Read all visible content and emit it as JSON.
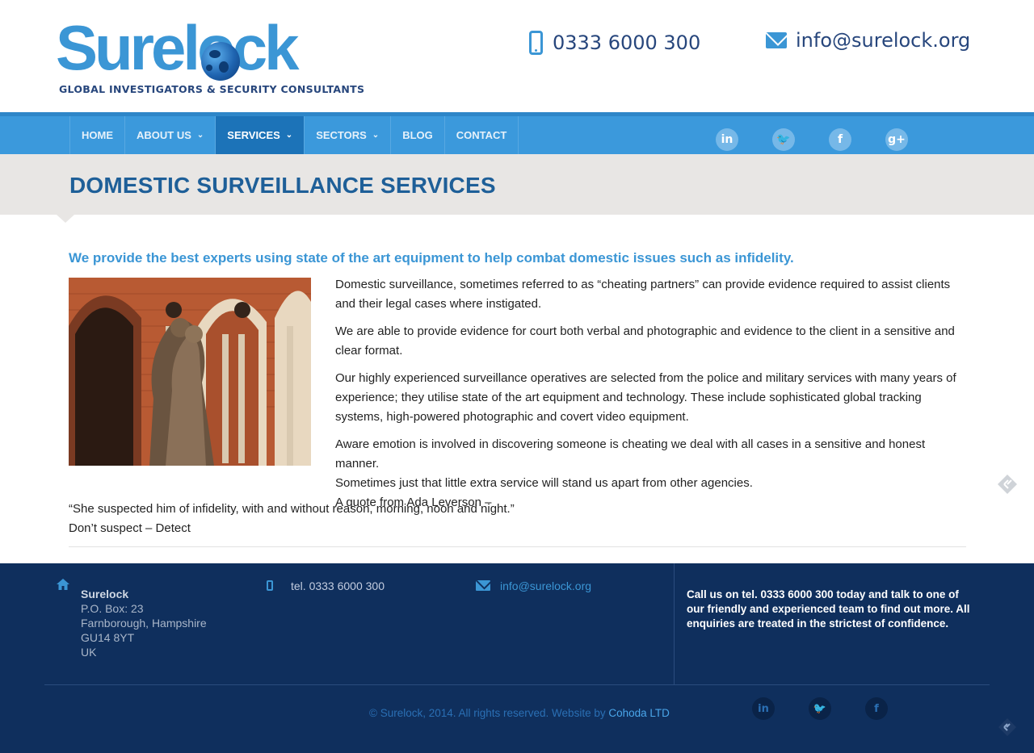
{
  "header": {
    "logo_text": "Surelock",
    "tagline": "GLOBAL INVESTIGATORS & SECURITY CONSULTANTS",
    "phone": "0333 6000 300",
    "email": "info@surelock.org"
  },
  "nav": {
    "items": [
      {
        "label": "HOME",
        "dropdown": false,
        "active": false
      },
      {
        "label": "ABOUT US",
        "dropdown": true,
        "active": false
      },
      {
        "label": "SERVICES",
        "dropdown": true,
        "active": true
      },
      {
        "label": "SECTORS",
        "dropdown": true,
        "active": false
      },
      {
        "label": "BLOG",
        "dropdown": false,
        "active": false
      },
      {
        "label": "CONTACT",
        "dropdown": false,
        "active": false
      }
    ],
    "dropdown_glyph": "⌄",
    "social": [
      {
        "icon": "linkedin-icon",
        "glyph": "in"
      },
      {
        "icon": "twitter-icon",
        "glyph": "🐦"
      },
      {
        "icon": "facebook-icon",
        "glyph": "f"
      },
      {
        "icon": "google-plus-icon",
        "glyph": "g+"
      }
    ]
  },
  "page": {
    "title": "DOMESTIC SURVEILLANCE SERVICES",
    "subtitle": "We provide the best experts using state of the art equipment to help combat domestic issues such as infidelity.",
    "paragraphs": [
      "Domestic surveillance, sometimes referred to as “cheating partners” can provide evidence required to assist clients and their legal cases where instigated.",
      "We are able to provide evidence for court both verbal and photographic and evidence to the client in a sensitive and clear format.",
      "Our highly experienced surveillance operatives are selected from the police and military services with many years of experience; they utilise state of the art equipment and technology. These include sophisticated global tracking systems, high-powered photographic and covert video equipment.",
      "Aware emotion is involved in discovering someone is cheating we deal with all cases in a sensitive and honest manner.",
      "Sometimes just that little extra service will stand us apart from other agencies.",
      "A quote from Ada Leverson –"
    ],
    "quote": "“She suspected him of infidelity, with and without reason, morning, noon and night.”",
    "closing": "Don’t suspect – Detect"
  },
  "footer": {
    "org": "Surelock",
    "address_lines": [
      "P.O. Box: 23",
      "Farnborough, Hampshire",
      "GU14 8YT",
      "UK"
    ],
    "tel": "tel. 0333 6000 300",
    "email": "info@surelock.org",
    "callus": "Call us on tel. 0333 6000 300 today and talk to one of our friendly and experienced team to find out more. All enquiries are treated in the strictest of confidence.",
    "copyright": "© Surelock, 2014. All rights reserved. Website by ",
    "credit_link": "Cohoda LTD",
    "social": [
      {
        "icon": "linkedin-icon",
        "glyph": "in"
      },
      {
        "icon": "twitter-icon",
        "glyph": "🐦"
      },
      {
        "icon": "facebook-icon",
        "glyph": "f"
      }
    ]
  },
  "colors": {
    "brand_blue": "#3b96d5",
    "nav_blue": "#3b99dc",
    "nav_active": "#1c73b8",
    "title_blue": "#1e5f98",
    "footer_navy": "#0f2f5d"
  }
}
